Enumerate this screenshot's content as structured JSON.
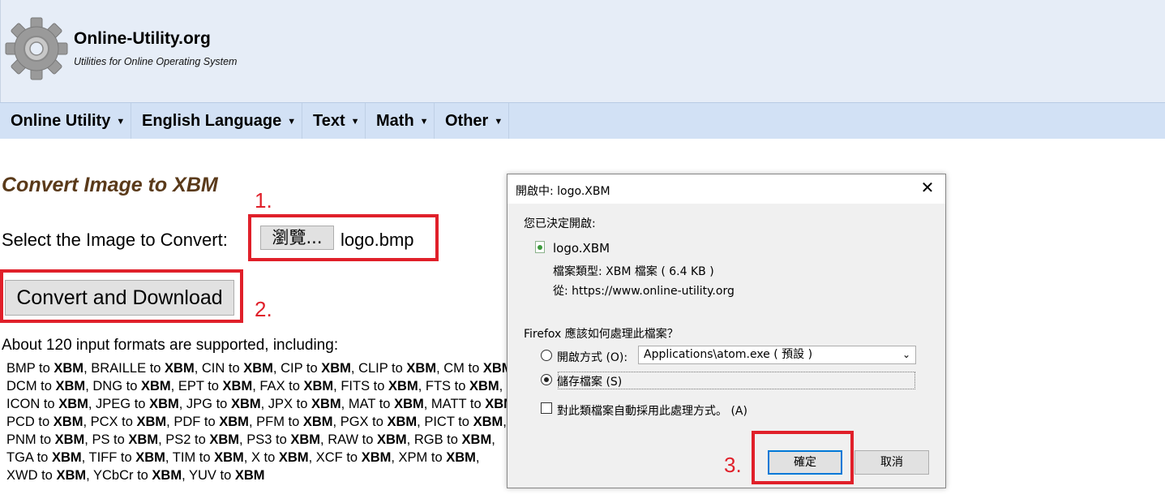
{
  "header": {
    "site_name": "Online-Utility.org",
    "tagline": "Utilities for Online Operating System"
  },
  "nav": {
    "items": [
      {
        "label": "Online Utility"
      },
      {
        "label": "English Language"
      },
      {
        "label": "Text"
      },
      {
        "label": "Math"
      },
      {
        "label": "Other"
      }
    ],
    "caret": "▼"
  },
  "main": {
    "title": "Convert Image to XBM",
    "select_label": "Select the Image to Convert:",
    "browse_label": "瀏覽...",
    "file_name": "logo.bmp",
    "convert_label": "Convert and Download",
    "formats_intro": "About 120 input formats are supported, including:",
    "formats_lines": [
      [
        "BMP",
        "BRAILLE",
        "CIN",
        "CIP",
        "CLIP",
        "CM"
      ],
      [
        "DCM",
        "DNG",
        "EPT",
        "FAX",
        "FITS",
        "FTS"
      ],
      [
        "ICON",
        "JPEG",
        "JPG",
        "JPX",
        "MAT",
        "MATT"
      ],
      [
        "PCD",
        "PCX",
        "PDF",
        "PFM",
        "PGX",
        "PICT"
      ],
      [
        "PNM",
        "PS",
        "PS2",
        "PS3",
        "RAW",
        "RGB"
      ],
      [
        "TGA",
        "TIFF",
        "TIM",
        "X",
        "XCF",
        "XPM"
      ],
      [
        "XWD",
        "YCbCr",
        "YUV"
      ]
    ],
    "target_format": "XBM",
    "connector": "to"
  },
  "annotations": {
    "step1": "1.",
    "step2": "2.",
    "step3": "3."
  },
  "dialog": {
    "title": "開啟中: logo.XBM",
    "intro": "您已決定開啟:",
    "file_name": "logo.XBM",
    "file_type": "檔案類型: XBM 檔案 ( 6.4 KB )",
    "from": "從: https://www.online-utility.org",
    "question": "Firefox 應該如何處理此檔案？",
    "open_with_label": "開啟方式 (O):",
    "open_with_app": "Applications\\atom.exe ( 預設 )",
    "save_label": "儲存檔案 (S)",
    "auto_label": "對此類檔案自動採用此處理方式。 (A)",
    "ok_label": "確定",
    "cancel_label": "取消",
    "close_glyph": "✕",
    "selected_option": "save"
  },
  "colors": {
    "annotation": "#e0202a",
    "header_bg": "#e6edf7",
    "nav_bg": "#d2e1f5",
    "title_color": "#5a3a1a",
    "focus_blue": "#0078d7"
  }
}
